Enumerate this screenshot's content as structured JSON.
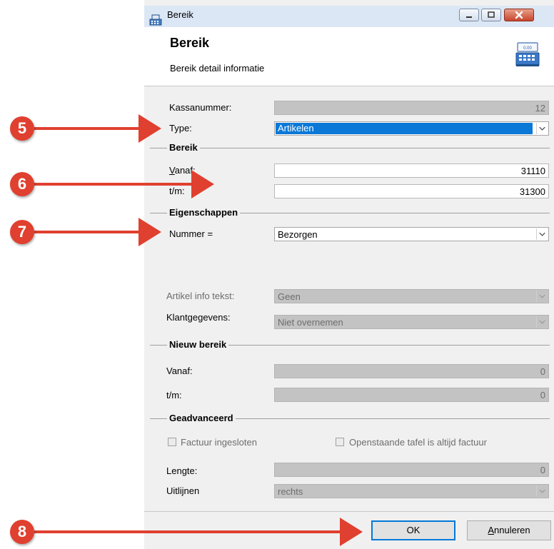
{
  "window": {
    "title": "Bereik"
  },
  "header": {
    "title": "Bereik",
    "subtitle": "Bereik detail informatie"
  },
  "fields": {
    "kassanummer": {
      "label": "Kassanummer:",
      "value": "12"
    },
    "type": {
      "label": "Type:",
      "value": "Artikelen"
    }
  },
  "bereik": {
    "title": "Bereik",
    "vanaf": {
      "label_first": "V",
      "label_rest": "anaf:",
      "value": "31110"
    },
    "tm": {
      "label": "t/m:",
      "value": "31300"
    }
  },
  "eigenschappen": {
    "title": "Eigenschappen",
    "nummer": {
      "label": "Nummer =",
      "value": "Bezorgen"
    },
    "artikel_info": {
      "label": "Artikel info tekst:",
      "value": "Geen"
    },
    "klantgegevens": {
      "label": "Klantgegevens:",
      "value": "Niet overnemen"
    }
  },
  "nieuw_bereik": {
    "title": "Nieuw bereik",
    "vanaf": {
      "label": "Vanaf:",
      "value": "0"
    },
    "tm": {
      "label": "t/m:",
      "value": "0"
    }
  },
  "geadvanceerd": {
    "title": "Geadvanceerd",
    "factuur_ingesloten": "Factuur ingesloten",
    "openstaande_tafel": "Openstaande tafel is altijd factuur",
    "lengte": {
      "label": "Lengte:",
      "value": "0"
    },
    "uitlijnen": {
      "label": "Uitlijnen",
      "value": "rechts"
    }
  },
  "footer": {
    "ok": "OK",
    "cancel_first": "A",
    "cancel_rest": "nnuleren"
  },
  "callouts": [
    "5",
    "6",
    "7",
    "8"
  ],
  "colors": {
    "callout": "#e0402f",
    "selection": "#0a78d7",
    "ok_border": "#0078d7"
  }
}
